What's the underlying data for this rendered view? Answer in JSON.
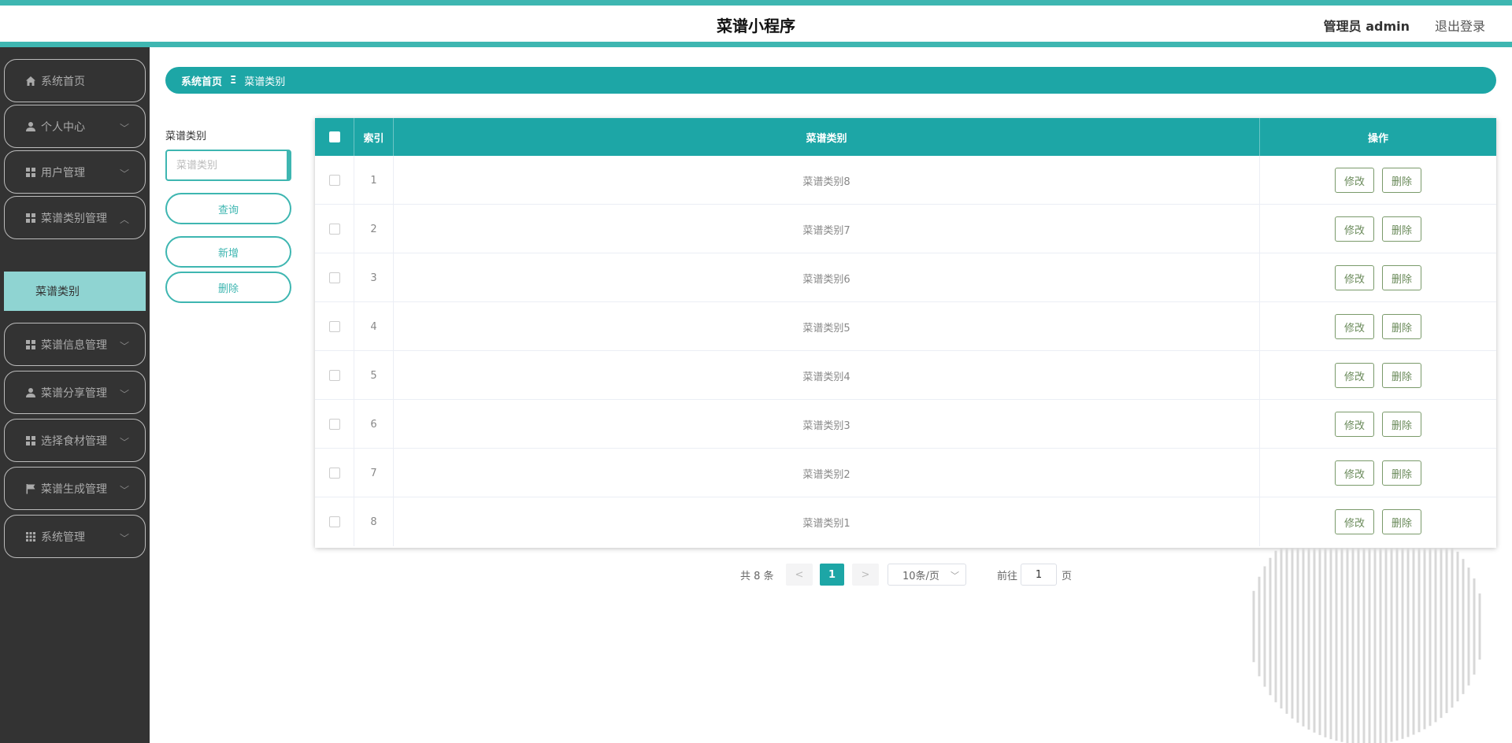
{
  "header": {
    "title": "菜谱小程序",
    "user": "管理员 admin",
    "logout": "退出登录"
  },
  "sidebar": {
    "items": [
      {
        "label": "系统首页",
        "icon": "home-icon"
      },
      {
        "label": "个人中心",
        "icon": "user-icon"
      },
      {
        "label": "用户管理",
        "icon": "grid-icon"
      },
      {
        "label": "菜谱类别管理",
        "icon": "grid-icon"
      },
      {
        "label": "菜谱信息管理",
        "icon": "grid-icon"
      },
      {
        "label": "菜谱分享管理",
        "icon": "user-icon"
      },
      {
        "label": "选择食材管理",
        "icon": "grid-icon"
      },
      {
        "label": "菜谱生成管理",
        "icon": "flag-icon"
      },
      {
        "label": "系统管理",
        "icon": "apps-icon"
      }
    ],
    "submenu": {
      "label": "菜谱类别"
    }
  },
  "breadcrumb": {
    "home": "系统首页",
    "separator": "Ξ",
    "current": "菜谱类别"
  },
  "search": {
    "label": "菜谱类别",
    "placeholder": "菜谱类别",
    "query_label": "查询",
    "add_label": "新增",
    "delete_label": "删除"
  },
  "table": {
    "headers": {
      "index": "索引",
      "name": "菜谱类别",
      "action": "操作"
    },
    "rows": [
      {
        "index": "1",
        "name": "菜谱类别8"
      },
      {
        "index": "2",
        "name": "菜谱类别7"
      },
      {
        "index": "3",
        "name": "菜谱类别6"
      },
      {
        "index": "4",
        "name": "菜谱类别5"
      },
      {
        "index": "5",
        "name": "菜谱类别4"
      },
      {
        "index": "6",
        "name": "菜谱类别3"
      },
      {
        "index": "7",
        "name": "菜谱类别2"
      },
      {
        "index": "8",
        "name": "菜谱类别1"
      }
    ],
    "edit_label": "修改",
    "delete_label": "删除"
  },
  "pagination": {
    "total": "共 8 条",
    "prev": "<",
    "current_page": "1",
    "next": ">",
    "page_size": "10条/页",
    "goto_prefix": "前往",
    "goto_value": "1",
    "goto_suffix": "页"
  },
  "colors": {
    "accent": "#1da6a6",
    "accent_light": "#3eb6b1",
    "sidebar_bg": "#333333",
    "submenu_active": "#8fd4d2"
  }
}
